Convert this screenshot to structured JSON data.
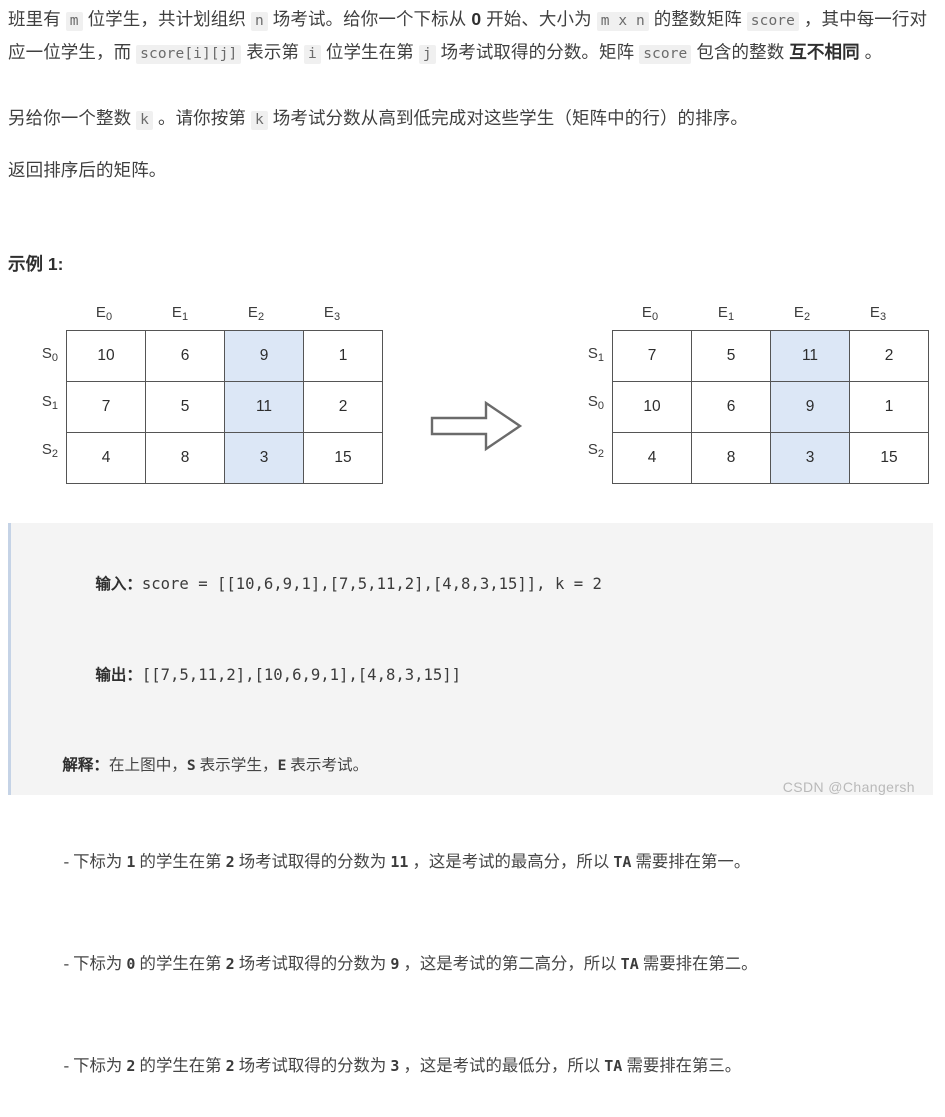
{
  "document": {
    "paragraphs": {
      "p1_seg1": "班里有 ",
      "p1_code1": "m",
      "p1_seg2": " 位学生，共计划组织 ",
      "p1_code2": "n",
      "p1_seg3": " 场考试。给你一个下标从 ",
      "p1_bold1": "0",
      "p1_seg4": " 开始、大小为 ",
      "p1_code3": "m x n",
      "p1_seg5": " 的整数矩阵 ",
      "p1_code4": "score",
      "p1_seg6": " ，其中每一行对应一位学生，而 ",
      "p1_code5": "score[i][j]",
      "p1_seg7": " 表示第 ",
      "p1_code6": "i",
      "p1_seg8": " 位学生在第 ",
      "p1_code7": "j",
      "p1_seg9": " 场考试取得的分数。矩阵 ",
      "p1_code8": "score",
      "p1_seg10": " 包含的整数 ",
      "p1_bold2": "互不相同",
      "p1_seg11": " 。",
      "p2_seg1": "另给你一个整数 ",
      "p2_code1": "k",
      "p2_seg2": " 。请你按第 ",
      "p2_code2": "k",
      "p2_seg3": " 场考试分数从高到低完成对这些学生（矩阵中的行）的排序。",
      "p3_text": "返回排序后的矩阵。"
    },
    "example_heading": "示例 1:",
    "watermark": "CSDN @Changersh"
  },
  "diagram": {
    "highlight_color": "#dce7f6",
    "arrow_icon": "right-arrow-icon",
    "left_matrix": {
      "col_labels": [
        "E",
        "E",
        "E",
        "E"
      ],
      "col_subs": [
        "0",
        "1",
        "2",
        "3"
      ],
      "row_labels": [
        "S",
        "S",
        "S"
      ],
      "row_subs": [
        "0",
        "1",
        "2"
      ],
      "highlight_col_index": 2,
      "rows": [
        [
          "10",
          "6",
          "9",
          "1"
        ],
        [
          "7",
          "5",
          "11",
          "2"
        ],
        [
          "4",
          "8",
          "3",
          "15"
        ]
      ]
    },
    "right_matrix": {
      "col_labels": [
        "E",
        "E",
        "E",
        "E"
      ],
      "col_subs": [
        "0",
        "1",
        "2",
        "3"
      ],
      "row_labels": [
        "S",
        "S",
        "S"
      ],
      "row_subs": [
        "1",
        "0",
        "2"
      ],
      "highlight_col_index": 2,
      "rows": [
        [
          "7",
          "5",
          "11",
          "2"
        ],
        [
          "10",
          "6",
          "9",
          "1"
        ],
        [
          "4",
          "8",
          "3",
          "15"
        ]
      ]
    }
  },
  "example_block": {
    "input_label": "输入：",
    "input_value": "score = [[10,6,9,1],[7,5,11,2],[4,8,3,15]], k = 2",
    "output_label": "输出：",
    "output_value": "[[7,5,11,2],[10,6,9,1],[4,8,3,15]]",
    "explain_label": "解释：",
    "explain_pre": "在上图中，",
    "explain_s": "S",
    "explain_mid1": " 表示学生，",
    "explain_e": "E",
    "explain_mid2": " 表示考试。",
    "bullets": [
      {
        "prefix": "- 下标为 ",
        "index": "1",
        "mid1": " 的学生在第 ",
        "exam": "2",
        "mid2": " 场考试取得的分数为 ",
        "score": "11",
        "mid3": " ，这是考试的最高分，所以 ",
        "ta": "TA",
        "suffix": " 需要排在第一。"
      },
      {
        "prefix": "- 下标为 ",
        "index": "0",
        "mid1": " 的学生在第 ",
        "exam": "2",
        "mid2": " 场考试取得的分数为 ",
        "score": "9",
        "mid3": " ，这是考试的第二高分，所以 ",
        "ta": "TA",
        "suffix": " 需要排在第二。"
      },
      {
        "prefix": "- 下标为 ",
        "index": "2",
        "mid1": " 的学生在第 ",
        "exam": "2",
        "mid2": " 场考试取得的分数为 ",
        "score": "3",
        "mid3": " ，这是考试的最低分，所以 ",
        "ta": "TA",
        "suffix": " 需要排在第三。"
      }
    ]
  }
}
